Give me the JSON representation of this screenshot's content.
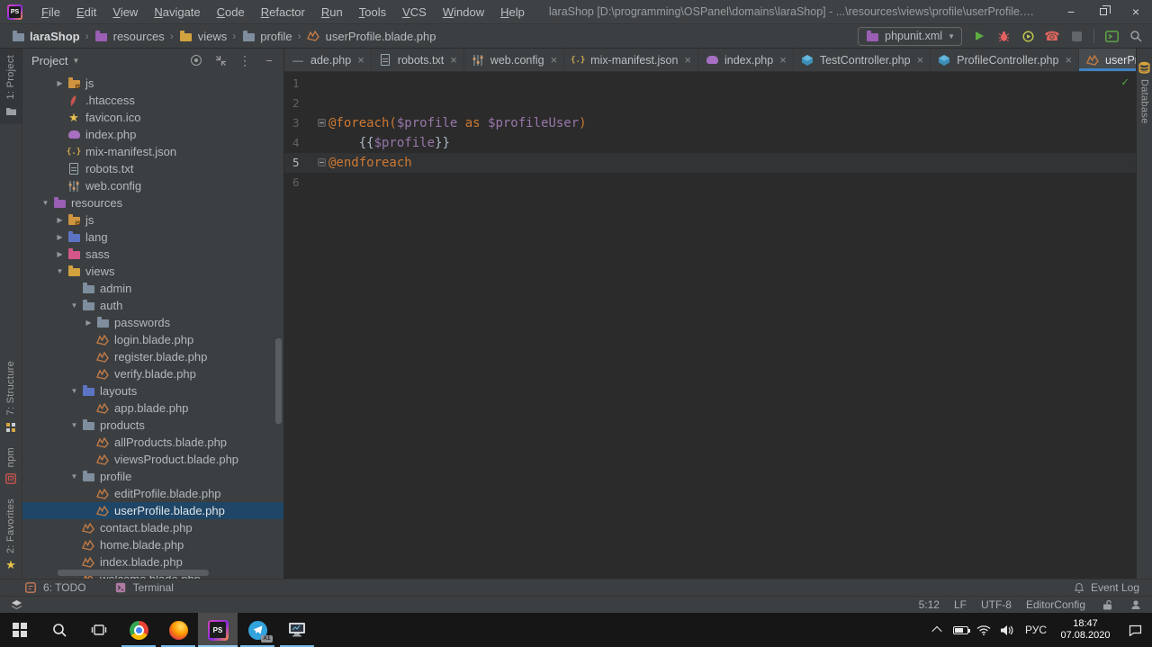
{
  "window": {
    "title": "laraShop [D:\\programming\\OSPanel\\domains\\laraShop] - ...\\resources\\views\\profile\\userProfile.blade.php - PhpStorm"
  },
  "menubar": {
    "menus": [
      "File",
      "Edit",
      "View",
      "Navigate",
      "Code",
      "Refactor",
      "Run",
      "Tools",
      "VCS",
      "Window",
      "Help"
    ]
  },
  "breadcrumbs": [
    {
      "label": "laraShop",
      "icon": "folder"
    },
    {
      "label": "resources",
      "icon": "folder-resources"
    },
    {
      "label": "views",
      "icon": "folder-views"
    },
    {
      "label": "profile",
      "icon": "folder"
    },
    {
      "label": "userProfile.blade.php",
      "icon": "blade"
    }
  ],
  "run_widget": {
    "config_name": "phpunit.xml"
  },
  "colors": {
    "keyword_orange": "#cc7832",
    "variable_purple": "#9876aa",
    "plain_gray": "#a9b7c6",
    "selection_blue": "#1f4666",
    "tab_underline_blue": "#3e83c5",
    "run_green": "#5cac42",
    "debug_red": "#e36161",
    "taskbar_indicator_blue": "#76b9e8"
  },
  "project_panel": {
    "title": "Project",
    "tree": [
      {
        "label": "js",
        "icon": "folder-js",
        "level": 3,
        "expand": "closed"
      },
      {
        "label": ".htaccess",
        "icon": "htaccess",
        "level": 3
      },
      {
        "label": "favicon.ico",
        "icon": "star",
        "level": 3
      },
      {
        "label": "index.php",
        "icon": "php",
        "level": 3
      },
      {
        "label": "mix-manifest.json",
        "icon": "json",
        "level": 3
      },
      {
        "label": "robots.txt",
        "icon": "text-file",
        "level": 3
      },
      {
        "label": "web.config",
        "icon": "config",
        "level": 3
      },
      {
        "label": "resources",
        "icon": "folder-resources",
        "level": 2,
        "expand": "open"
      },
      {
        "label": "js",
        "icon": "folder-js",
        "level": 3,
        "expand": "closed"
      },
      {
        "label": "lang",
        "icon": "folder-lang",
        "level": 3,
        "expand": "closed"
      },
      {
        "label": "sass",
        "icon": "folder-sass",
        "level": 3,
        "expand": "closed"
      },
      {
        "label": "views",
        "icon": "folder-views",
        "level": 3,
        "expand": "open"
      },
      {
        "label": "admin",
        "icon": "folder",
        "level": 4
      },
      {
        "label": "auth",
        "icon": "folder",
        "level": 4,
        "expand": "open"
      },
      {
        "label": "passwords",
        "icon": "folder",
        "level": 5,
        "expand": "closed"
      },
      {
        "label": "login.blade.php",
        "icon": "blade",
        "level": 5
      },
      {
        "label": "register.blade.php",
        "icon": "blade",
        "level": 5
      },
      {
        "label": "verify.blade.php",
        "icon": "blade",
        "level": 5
      },
      {
        "label": "layouts",
        "icon": "folder-layouts",
        "level": 4,
        "expand": "open"
      },
      {
        "label": "app.blade.php",
        "icon": "blade",
        "level": 5
      },
      {
        "label": "products",
        "icon": "folder",
        "level": 4,
        "expand": "open"
      },
      {
        "label": "allProducts.blade.php",
        "icon": "blade",
        "level": 5
      },
      {
        "label": "viewsProduct.blade.php",
        "icon": "blade",
        "level": 5
      },
      {
        "label": "profile",
        "icon": "folder",
        "level": 4,
        "expand": "open"
      },
      {
        "label": "editProfile.blade.php",
        "icon": "blade",
        "level": 5
      },
      {
        "label": "userProfile.blade.php",
        "icon": "blade",
        "level": 5,
        "selected": true
      },
      {
        "label": "contact.blade.php",
        "icon": "blade",
        "level": 4
      },
      {
        "label": "home.blade.php",
        "icon": "blade",
        "level": 4
      },
      {
        "label": "index.blade.php",
        "icon": "blade",
        "level": 4
      },
      {
        "label": "welcome.blade.php",
        "icon": "blade",
        "level": 4
      }
    ]
  },
  "left_stripe": {
    "items": [
      {
        "label": "1: Project",
        "icon": "project-tool",
        "active": true,
        "group": "top"
      },
      {
        "label": "7: Structure",
        "icon": "structure-tool",
        "group": "bottom"
      },
      {
        "label": "npm",
        "icon": "npm-tool",
        "group": "bottom"
      },
      {
        "label": "2: Favorites",
        "icon": "favorites-tool",
        "group": "bottom"
      }
    ]
  },
  "right_stripe": {
    "items": [
      {
        "label": "Database",
        "icon": "database-tool"
      }
    ]
  },
  "editor": {
    "tabs": [
      {
        "label": "ade.php",
        "icon": "dash"
      },
      {
        "label": "robots.txt",
        "icon": "text-file"
      },
      {
        "label": "web.config",
        "icon": "config"
      },
      {
        "label": "mix-manifest.json",
        "icon": "json"
      },
      {
        "label": "index.php",
        "icon": "php"
      },
      {
        "label": "TestController.php",
        "icon": "class"
      },
      {
        "label": "ProfileController.php",
        "icon": "class"
      },
      {
        "label": "userProfile.blade.php",
        "icon": "blade",
        "active": true
      }
    ],
    "hidden_tabs_count": "3",
    "lines": [
      {
        "num": "1",
        "tokens": []
      },
      {
        "num": "2",
        "tokens": []
      },
      {
        "num": "3",
        "fold": true,
        "tokens": [
          {
            "text": "@foreach(",
            "color": "kw"
          },
          {
            "text": "$profile",
            "color": "var"
          },
          {
            "text": " as ",
            "color": "kw"
          },
          {
            "text": "$profileUser",
            "color": "var"
          },
          {
            "text": ")",
            "color": "kw"
          }
        ]
      },
      {
        "num": "4",
        "tokens": [
          {
            "text": "    {{",
            "color": "pl"
          },
          {
            "text": "$profile",
            "color": "var"
          },
          {
            "text": "}}",
            "color": "pl"
          }
        ]
      },
      {
        "num": "5",
        "fold": true,
        "current": true,
        "tokens": [
          {
            "text": "@endforeach",
            "color": "kw"
          }
        ]
      },
      {
        "num": "6",
        "tokens": []
      }
    ]
  },
  "tool_bar": {
    "todo": "6: TODO",
    "terminal": "Terminal",
    "event_log": "Event Log"
  },
  "status_bar": {
    "position": "5:12",
    "line_ending": "LF",
    "encoding": "UTF-8",
    "editorconfig": "EditorConfig"
  },
  "taskbar": {
    "apps": [
      {
        "name": "start"
      },
      {
        "name": "search"
      },
      {
        "name": "task-view"
      },
      {
        "name": "chrome",
        "running": true
      },
      {
        "name": "firefox",
        "running": true
      },
      {
        "name": "phpstorm",
        "running": true,
        "active": true
      },
      {
        "name": "telegram",
        "running": true,
        "badge": "A1"
      },
      {
        "name": "system-monitor",
        "running": true
      }
    ],
    "tray": {
      "language": "РУС",
      "time": "18:47",
      "date": "07.08.2020"
    }
  }
}
